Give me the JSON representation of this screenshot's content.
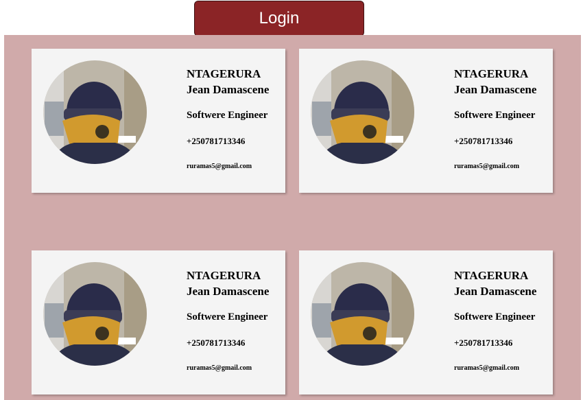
{
  "header": {
    "login_label": "Login"
  },
  "cards": [
    {
      "first_name": "NTAGERURA",
      "last_name": "Jean Damascene",
      "role": "Softwere Engineer",
      "phone": "+250781713346",
      "email": "ruramas5@gmail.com"
    },
    {
      "first_name": "NTAGERURA",
      "last_name": "Jean Damascene",
      "role": "Softwere Engineer",
      "phone": "+250781713346",
      "email": "ruramas5@gmail.com"
    },
    {
      "first_name": "NTAGERURA",
      "last_name": "Jean Damascene",
      "role": "Softwere Engineer",
      "phone": "+250781713346",
      "email": "ruramas5@gmail.com"
    },
    {
      "first_name": "NTAGERURA",
      "last_name": "Jean Damascene",
      "role": "Softwere Engineer",
      "phone": "+250781713346",
      "email": "ruramas5@gmail.com"
    }
  ],
  "colors": {
    "login_button": "#8b2426",
    "board_background": "#d0aaaa",
    "card_background": "#f4f4f4"
  }
}
